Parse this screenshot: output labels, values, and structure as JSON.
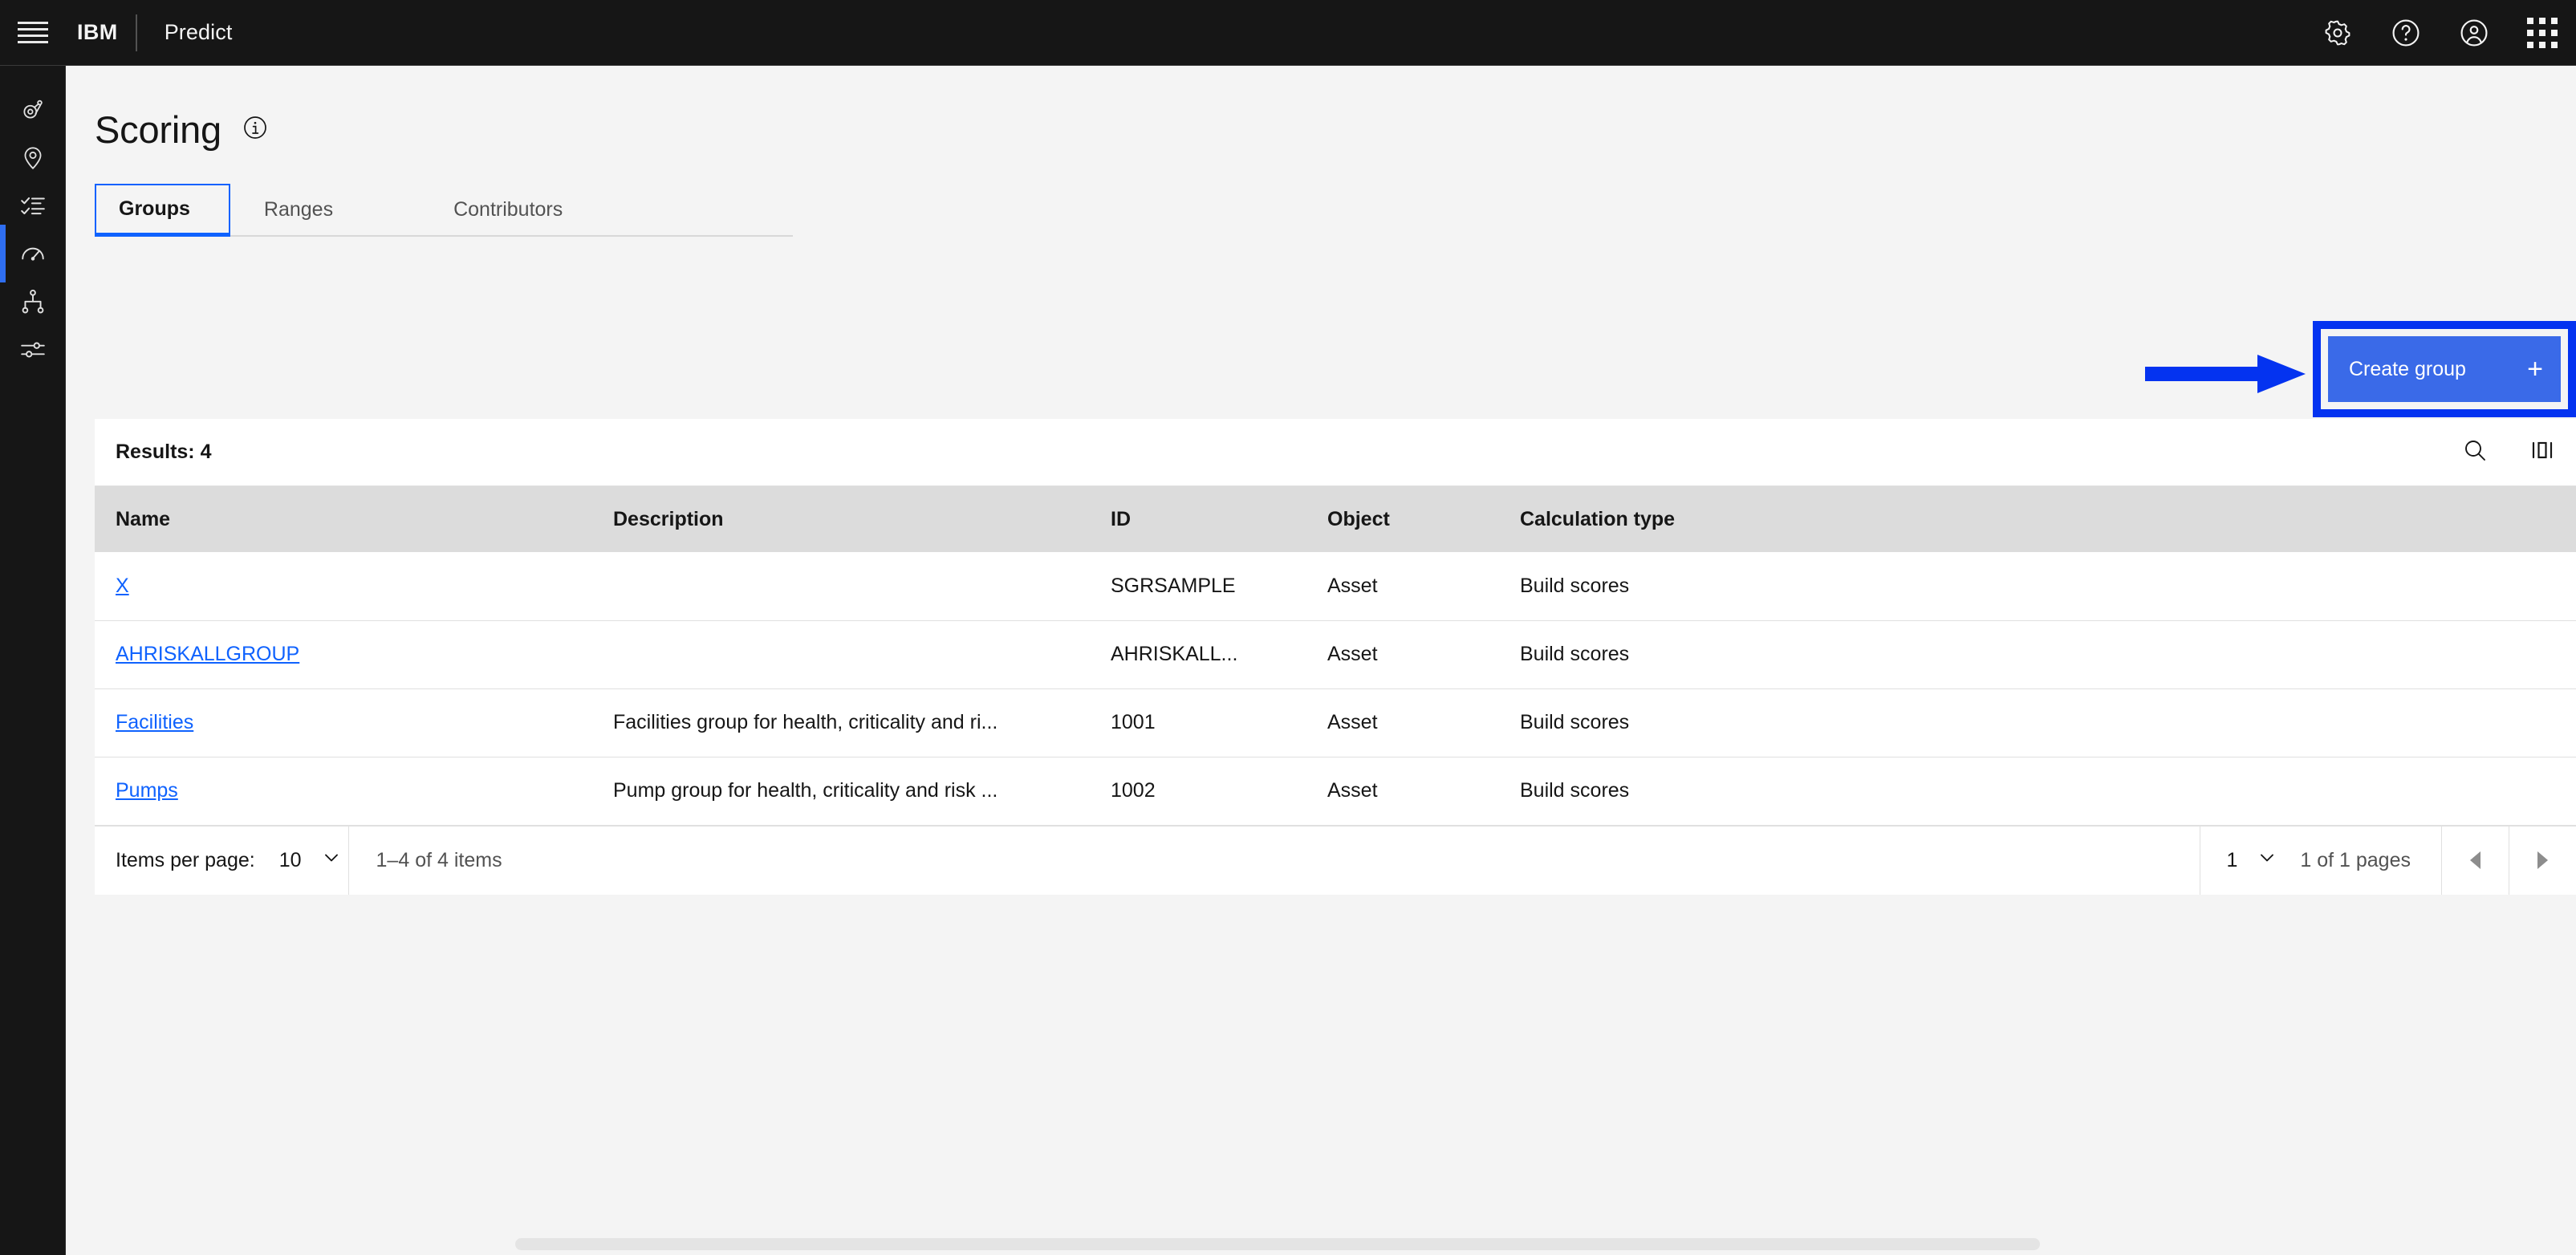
{
  "header": {
    "menu_icon": "hamburger-menu-icon",
    "brand": "IBM",
    "product": "Predict",
    "actions": [
      {
        "name": "settings",
        "icon": "gear-icon"
      },
      {
        "name": "help",
        "icon": "question-circle-icon"
      },
      {
        "name": "account",
        "icon": "user-avatar-icon"
      },
      {
        "name": "app-switcher",
        "icon": "grid-dots-icon"
      }
    ]
  },
  "sidebar": {
    "items": [
      {
        "name": "assets",
        "icon": "pulley-asset-icon",
        "active": false
      },
      {
        "name": "locations",
        "icon": "location-pin-icon",
        "active": false
      },
      {
        "name": "tasks",
        "icon": "checklist-icon",
        "active": false
      },
      {
        "name": "scoring",
        "icon": "gauge-meter-icon",
        "active": true
      },
      {
        "name": "hierarchy",
        "icon": "hierarchy-tree-icon",
        "active": false
      },
      {
        "name": "settings",
        "icon": "sliders-icon",
        "active": false
      }
    ]
  },
  "page": {
    "title": "Scoring",
    "info_icon": "info-circle-icon"
  },
  "tabs": [
    {
      "label": "Groups",
      "selected": true
    },
    {
      "label": "Ranges",
      "selected": false
    },
    {
      "label": "Contributors",
      "selected": false
    }
  ],
  "actions": {
    "create_group_label": "Create group",
    "create_group_plus": "+",
    "annotation_color": "#0433f0",
    "button_color": "#3a6ae8"
  },
  "table": {
    "results_label": "Results: 4",
    "toolbar_icons": [
      {
        "name": "search",
        "icon": "search-icon"
      },
      {
        "name": "column-settings",
        "icon": "column-bars-icon"
      }
    ],
    "columns": [
      "Name",
      "Description",
      "ID",
      "Object",
      "Calculation type"
    ],
    "rows": [
      {
        "name": "X",
        "description": "",
        "id": "SGRSAMPLE",
        "object": "Asset",
        "calculation_type": "Build scores"
      },
      {
        "name": "AHRISKALLGROUP",
        "description": "",
        "id": "AHRISKALL...",
        "object": "Asset",
        "calculation_type": "Build scores"
      },
      {
        "name": "Facilities",
        "description": "Facilities group for health, criticality and ri...",
        "id": "1001",
        "object": "Asset",
        "calculation_type": "Build scores"
      },
      {
        "name": "Pumps",
        "description": "Pump group for health, criticality and risk ...",
        "id": "1002",
        "object": "Asset",
        "calculation_type": "Build scores"
      }
    ]
  },
  "pagination": {
    "items_per_page_label": "Items per page:",
    "items_per_page_value": "10",
    "range_text": "1–4 of 4 items",
    "page_value": "1",
    "pages_text": "1 of 1 pages",
    "prev_icon": "caret-left-icon",
    "next_icon": "caret-right-icon"
  }
}
